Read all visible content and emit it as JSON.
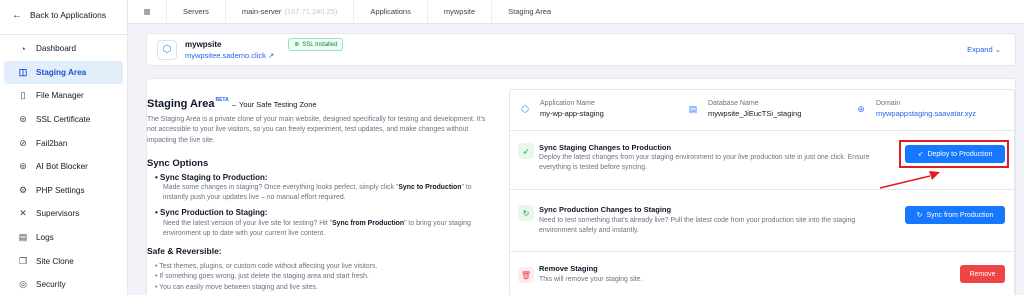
{
  "sidebar": {
    "back_label": "Back to Applications",
    "items": [
      {
        "label": "Dashboard",
        "icon": "speedometer-icon"
      },
      {
        "label": "Staging Area",
        "icon": "stack-icon",
        "active": true
      },
      {
        "label": "File Manager",
        "icon": "file-icon"
      },
      {
        "label": "SSL Certificate",
        "icon": "ssl-certificate-icon"
      },
      {
        "label": "Fail2ban",
        "icon": "ban-icon"
      },
      {
        "label": "AI Bot Blocker",
        "icon": "robot-icon"
      },
      {
        "label": "PHP Settings",
        "icon": "gear-icon"
      },
      {
        "label": "Supervisors",
        "icon": "tools-icon"
      },
      {
        "label": "Logs",
        "icon": "document-icon"
      },
      {
        "label": "Site Clone",
        "icon": "clone-icon"
      },
      {
        "label": "Security",
        "icon": "shield-icon"
      }
    ]
  },
  "breadcrumb": {
    "servers": "Servers",
    "server": "main-server",
    "server_ip": "(167.71.240.25)",
    "applications": "Applications",
    "app": "mywpsite",
    "current": "Staging Area"
  },
  "site": {
    "name": "mywpsite",
    "url": "mywpsitee.sademo.click",
    "ssl_label": "SSL Installed",
    "expand_label": "Expand"
  },
  "staging": {
    "title": "Staging Area",
    "beta": "BETA",
    "dash": "–",
    "subtitle": "Your Safe Testing Zone",
    "description": "The Staging Area is a private clone of your main website, designed specifically for testing and development. It's not accessible to your live visitors, so you can freely experiment, test updates, and make changes without impacting the live site.",
    "sync_options_title": "Sync Options",
    "sync_to_prod_title": "Sync Staging to Production:",
    "sync_to_prod_desc_pre": "Made some changes in staging? Once everything looks perfect, simply click \"",
    "sync_to_prod_desc_bold": "Sync to Production",
    "sync_to_prod_desc_post": "\" to instantly push your updates live – no manual effort required.",
    "sync_to_staging_title": "Sync Production to Staging:",
    "sync_to_staging_desc_pre": "Need the latest version of your live site for testing? Hit \"",
    "sync_to_staging_desc_bold": "Sync from Production",
    "sync_to_staging_desc_post": "\" to bring your staging environment up to date with your current live content.",
    "safe_title": "Safe & Reversible:",
    "safe_items": [
      "Test themes, plugins, or custom code without affecting your live visitors.",
      "If something goes wrong, just delete the staging area and start fresh.",
      "You can easily move between staging and live sites."
    ]
  },
  "info": {
    "app_label": "Application Name",
    "app_value": "my-wp-app-staging",
    "db_label": "Database Name",
    "db_value": "mywpsite_JiEucTSi_staging",
    "domain_label": "Domain",
    "domain_value": "mywpappstaging.saavatar.xyz"
  },
  "actions": {
    "deploy_title": "Sync Staging Changes to Production",
    "deploy_desc": "Deploy the latest changes from your staging environment to your live production site in just one click. Ensure everything is tested before syncing.",
    "deploy_button": "Deploy to Production",
    "sync_title": "Sync Production Changes to Staging",
    "sync_desc": "Need to test something that's already live? Pull the latest code from your production site into the staging environment safely and instantly.",
    "sync_button": "Sync from Production",
    "remove_title": "Remove Staging",
    "remove_desc": "This will remove your staging site.",
    "remove_button": "Remove"
  },
  "colors": {
    "accent": "#1677ff",
    "danger": "#ef4444",
    "highlight": "#e11d1d",
    "success": "#15803d"
  }
}
